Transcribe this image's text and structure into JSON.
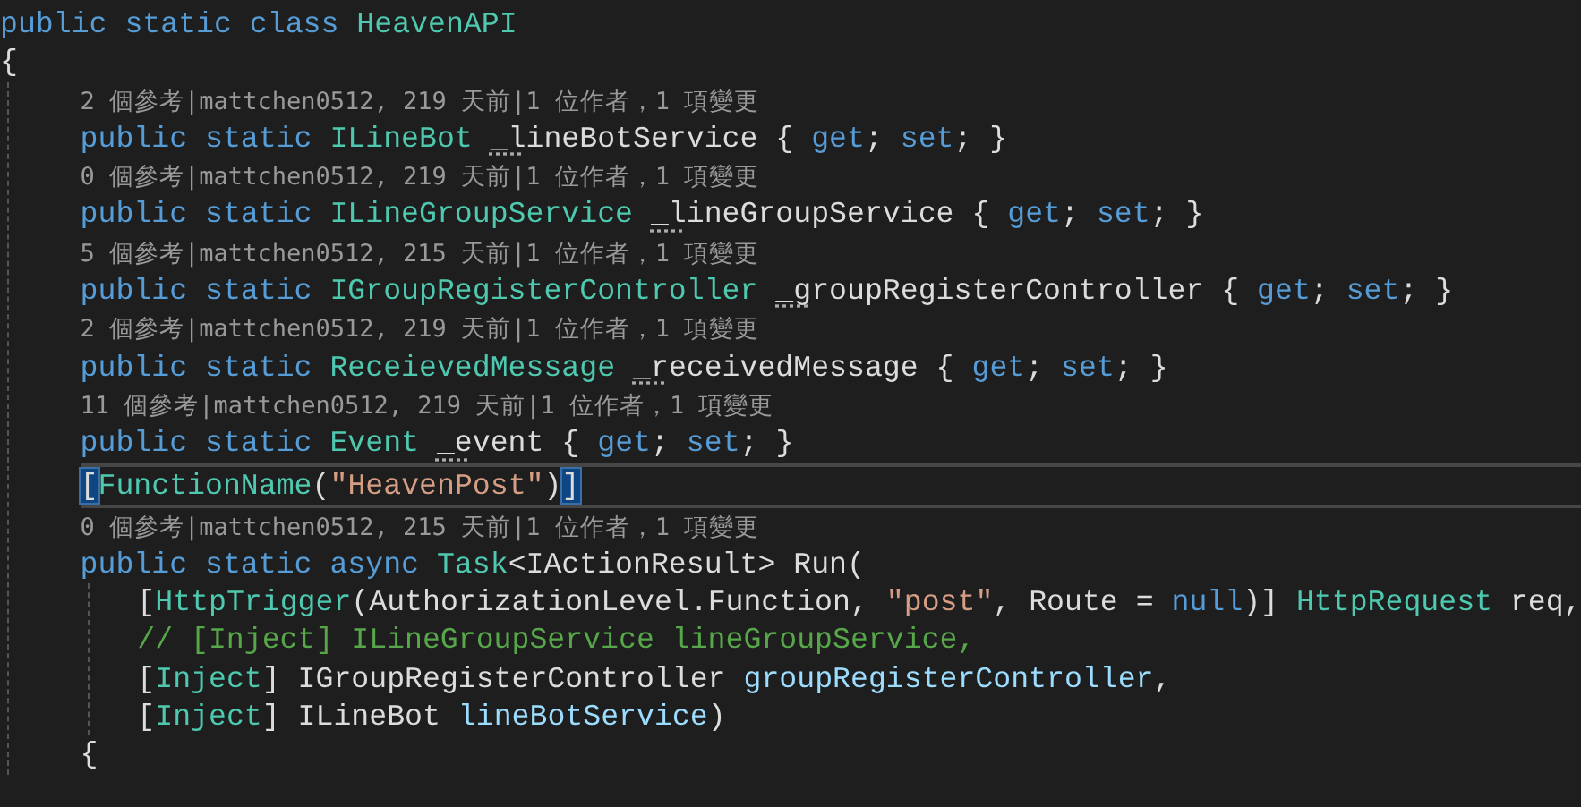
{
  "editor": {
    "lines": [
      {
        "kind": "code",
        "current": false,
        "tokens": [
          {
            "text": "public static class ",
            "kind": "keyword"
          },
          {
            "text": "HeavenAPI",
            "kind": "type"
          }
        ]
      },
      {
        "kind": "code",
        "current": false,
        "tokens": [
          {
            "text": "{",
            "kind": "plain"
          }
        ],
        "children": [
          {
            "kind": "lens",
            "text": "2 個參考|mattchen0512, 219 天前|1 位作者，1 項變更"
          },
          {
            "kind": "code",
            "current": false,
            "tokens": [
              {
                "text": "public static ",
                "kind": "keyword"
              },
              {
                "text": "ILineBot ",
                "kind": "type"
              },
              {
                "text": "_l",
                "kind": "plain",
                "suggestion": true
              },
              {
                "text": "ineBotService { ",
                "kind": "plain"
              },
              {
                "text": "get",
                "kind": "keyword"
              },
              {
                "text": "; ",
                "kind": "plain"
              },
              {
                "text": "set",
                "kind": "keyword"
              },
              {
                "text": "; }",
                "kind": "plain"
              }
            ]
          },
          {
            "kind": "lens",
            "text": "0 個參考|mattchen0512, 219 天前|1 位作者，1 項變更"
          },
          {
            "kind": "code",
            "current": false,
            "tokens": [
              {
                "text": "public static ",
                "kind": "keyword"
              },
              {
                "text": "ILineGroupService ",
                "kind": "type"
              },
              {
                "text": "_l",
                "kind": "plain",
                "suggestion": true
              },
              {
                "text": "ineGroupService { ",
                "kind": "plain"
              },
              {
                "text": "get",
                "kind": "keyword"
              },
              {
                "text": "; ",
                "kind": "plain"
              },
              {
                "text": "set",
                "kind": "keyword"
              },
              {
                "text": "; }",
                "kind": "plain"
              }
            ]
          },
          {
            "kind": "lens",
            "text": "5 個參考|mattchen0512, 215 天前|1 位作者，1 項變更"
          },
          {
            "kind": "code",
            "current": false,
            "tokens": [
              {
                "text": "public static ",
                "kind": "keyword"
              },
              {
                "text": "IGroupRegisterController ",
                "kind": "type"
              },
              {
                "text": "_g",
                "kind": "plain",
                "suggestion": true
              },
              {
                "text": "roupRegisterController { ",
                "kind": "plain"
              },
              {
                "text": "get",
                "kind": "keyword"
              },
              {
                "text": "; ",
                "kind": "plain"
              },
              {
                "text": "set",
                "kind": "keyword"
              },
              {
                "text": "; }",
                "kind": "plain"
              }
            ]
          },
          {
            "kind": "lens",
            "text": "2 個參考|mattchen0512, 219 天前|1 位作者，1 項變更"
          },
          {
            "kind": "code",
            "current": false,
            "tokens": [
              {
                "text": "public static ",
                "kind": "keyword"
              },
              {
                "text": "ReceievedMessage ",
                "kind": "type"
              },
              {
                "text": "_r",
                "kind": "plain",
                "suggestion": true
              },
              {
                "text": "eceivedMessage { ",
                "kind": "plain"
              },
              {
                "text": "get",
                "kind": "keyword"
              },
              {
                "text": "; ",
                "kind": "plain"
              },
              {
                "text": "set",
                "kind": "keyword"
              },
              {
                "text": "; }",
                "kind": "plain"
              }
            ]
          },
          {
            "kind": "lens",
            "text": "11 個參考|mattchen0512, 219 天前|1 位作者，1 項變更"
          },
          {
            "kind": "code",
            "current": false,
            "tokens": [
              {
                "text": "public static ",
                "kind": "keyword"
              },
              {
                "text": "Event ",
                "kind": "type"
              },
              {
                "text": "_e",
                "kind": "plain",
                "suggestion": true
              },
              {
                "text": "vent { ",
                "kind": "plain"
              },
              {
                "text": "get",
                "kind": "keyword"
              },
              {
                "text": "; ",
                "kind": "plain"
              },
              {
                "text": "set",
                "kind": "keyword"
              },
              {
                "text": "; }",
                "kind": "plain"
              }
            ]
          },
          {
            "kind": "code",
            "current": true,
            "tokens": [
              {
                "text": "[",
                "kind": "plain",
                "highlighted": true
              },
              {
                "text": "FunctionName",
                "kind": "type"
              },
              {
                "text": "(",
                "kind": "plain"
              },
              {
                "text": "\"HeavenPost\"",
                "kind": "string"
              },
              {
                "text": ")",
                "kind": "plain"
              },
              {
                "text": "]",
                "kind": "plain",
                "highlighted": true
              }
            ]
          },
          {
            "kind": "lens",
            "text": "0 個參考|mattchen0512, 215 天前|1 位作者，1 項變更"
          },
          {
            "kind": "code",
            "current": false,
            "tokens": [
              {
                "text": "public static async ",
                "kind": "keyword"
              },
              {
                "text": "Task",
                "kind": "type"
              },
              {
                "text": "<IActionResult> Run(",
                "kind": "plain"
              }
            ],
            "children": [
              {
                "kind": "code",
                "current": false,
                "tokens": [
                  {
                    "text": "[",
                    "kind": "plain"
                  },
                  {
                    "text": "HttpTrigger",
                    "kind": "type"
                  },
                  {
                    "text": "(AuthorizationLevel.Function, ",
                    "kind": "plain"
                  },
                  {
                    "text": "\"post\"",
                    "kind": "string"
                  },
                  {
                    "text": ", Route = ",
                    "kind": "plain"
                  },
                  {
                    "text": "null",
                    "kind": "keyword"
                  },
                  {
                    "text": ")] ",
                    "kind": "plain"
                  },
                  {
                    "text": "HttpRequest",
                    "kind": "type"
                  },
                  {
                    "text": " req,",
                    "kind": "plain"
                  }
                ]
              },
              {
                "kind": "code",
                "current": false,
                "tokens": [
                  {
                    "text": "// [Inject] ILineGroupService lineGroupService,",
                    "kind": "comment"
                  }
                ]
              },
              {
                "kind": "code",
                "current": false,
                "tokens": [
                  {
                    "text": "[",
                    "kind": "plain"
                  },
                  {
                    "text": "Inject",
                    "kind": "type"
                  },
                  {
                    "text": "] IGroupRegisterController ",
                    "kind": "plain"
                  },
                  {
                    "text": "groupRegisterController",
                    "kind": "param"
                  },
                  {
                    "text": ",",
                    "kind": "plain"
                  }
                ]
              },
              {
                "kind": "code",
                "current": false,
                "tokens": [
                  {
                    "text": "[",
                    "kind": "plain"
                  },
                  {
                    "text": "Inject",
                    "kind": "type"
                  },
                  {
                    "text": "] ILineBot ",
                    "kind": "plain"
                  },
                  {
                    "text": "lineBotService",
                    "kind": "param"
                  },
                  {
                    "text": ")",
                    "kind": "plain"
                  }
                ]
              }
            ]
          },
          {
            "kind": "code",
            "current": false,
            "tokens": [
              {
                "text": "{",
                "kind": "plain"
              }
            ]
          }
        ]
      }
    ]
  }
}
